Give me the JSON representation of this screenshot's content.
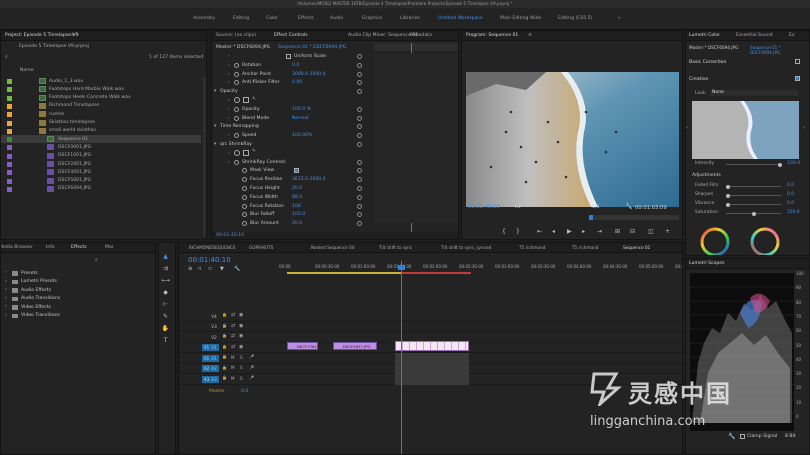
{
  "window_title": "/Volumes/MOSI2 MASTER 1KTB/Episode 4 Timelapse/Premiere Projects/Episode 5 Timelapse V9.prproj *",
  "workspaces": [
    {
      "label": "Assembly",
      "active": false
    },
    {
      "label": "Editing",
      "active": false
    },
    {
      "label": "Color",
      "active": false
    },
    {
      "label": "Effects",
      "active": false
    },
    {
      "label": "Audio",
      "active": false
    },
    {
      "label": "Graphics",
      "active": false
    },
    {
      "label": "Libraries",
      "active": false
    },
    {
      "label": "Untitled Workspace",
      "active": true
    },
    {
      "label": "Main Editing Wide",
      "active": false
    },
    {
      "label": "Editing (CS5.5)",
      "active": false
    },
    {
      "label": "»",
      "active": false
    }
  ],
  "project": {
    "title": "Project: Episode 5 Timelapse V9",
    "file": "Episode 5 Timelapse V9.prproj",
    "count": "1 of 127 items selected",
    "column": "Name",
    "items": [
      {
        "name": "Audio_1_3.wav",
        "color": "#6bbf3a",
        "kind": "audio"
      },
      {
        "name": "Footsteps Hard Marble Walk.wav",
        "color": "#6bbf3a",
        "kind": "audio"
      },
      {
        "name": "Footsteps Heels Concrete Walk.wav",
        "color": "#6bbf3a",
        "kind": "audio"
      },
      {
        "name": "Richmond Timelapses",
        "color": "#e8a43a",
        "kind": "folder"
      },
      {
        "name": "rushes",
        "color": "#e8a43a",
        "kind": "folder"
      },
      {
        "name": "Skiathos timelapses",
        "color": "#e8a43a",
        "kind": "folder"
      },
      {
        "name": "small world skiathos",
        "color": "#e8a43a",
        "kind": "folder"
      },
      {
        "name": "Sequence 01",
        "color": "#3a8a3a",
        "kind": "sequence"
      },
      {
        "name": "DSCF0001.JPG",
        "color": "#8a5cc7",
        "kind": "image"
      },
      {
        "name": "DSCF1001.JPG",
        "color": "#8a5cc7",
        "kind": "image"
      },
      {
        "name": "DSCF2001.JPG",
        "color": "#8a5cc7",
        "kind": "image"
      },
      {
        "name": "DSCF4001.JPG",
        "color": "#8a5cc7",
        "kind": "image"
      },
      {
        "name": "DSCF5001.JPG",
        "color": "#8a5cc7",
        "kind": "image"
      },
      {
        "name": "DSCF6094.JPG",
        "color": "#8a5cc7",
        "kind": "image"
      }
    ]
  },
  "source_tabs": [
    "Source: (no clips)",
    "Effect Controls",
    "Audio Clip Mixer: Sequence 01",
    "Metadata"
  ],
  "effect_controls": {
    "master": "Master * DSCF6094.JPG",
    "seq": "Sequence 01 * DSCF6094.JPG",
    "timecode": "00:01:40:10",
    "rows": [
      {
        "indent": 1,
        "label": "",
        "value": "",
        "check": "Uniform Scale"
      },
      {
        "indent": 1,
        "label": "Rotation",
        "value": "0.0"
      },
      {
        "indent": 1,
        "label": "Anchor Point",
        "value": "3000.0    2000.0"
      },
      {
        "indent": 1,
        "label": "Anti-flicker Filter",
        "value": "0.00"
      },
      {
        "indent": 0,
        "label": "Opacity",
        "value": ""
      },
      {
        "indent": 1,
        "label": "",
        "value": "",
        "shapes": true
      },
      {
        "indent": 1,
        "label": "Opacity",
        "value": "100.0 %"
      },
      {
        "indent": 1,
        "label": "Blend Mode",
        "value": "Normal"
      },
      {
        "indent": 0,
        "label": "Time Remapping",
        "value": ""
      },
      {
        "indent": 1,
        "label": "Speed",
        "value": "100.00%"
      },
      {
        "indent": 0,
        "label": "qrc ShrinkRay",
        "value": ""
      },
      {
        "indent": 1,
        "label": "",
        "value": "",
        "shapes": true
      },
      {
        "indent": 1,
        "label": "ShrinkRay Controls",
        "value": ""
      },
      {
        "indent": 2,
        "label": "Mask View",
        "value": "",
        "check": ""
      },
      {
        "indent": 2,
        "label": "Focus Position",
        "value": "3615.0    2000.0"
      },
      {
        "indent": 2,
        "label": "Focus Height",
        "value": "20.0"
      },
      {
        "indent": 2,
        "label": "Focus Width",
        "value": "88.0"
      },
      {
        "indent": 2,
        "label": "Focus Rotation",
        "value": "108"
      },
      {
        "indent": 2,
        "label": "Blur Falloff",
        "value": "100.0"
      },
      {
        "indent": 2,
        "label": "Blur Amount",
        "value": "20.0"
      }
    ]
  },
  "program": {
    "title": "Program: Sequence 01",
    "timecode": "00:01:40:10",
    "fit": "Fit",
    "res": "1/4",
    "duration": "00:01:03:09"
  },
  "lumetri": {
    "tabs": [
      "Lumetri Color",
      "Essential Sound",
      "Ex"
    ],
    "master": "Master * DSCF6094.JPG",
    "seq": "Sequence 01 * DSCF6094.JPG",
    "basic": "Basic Correction",
    "creative": "Creative",
    "look_label": "Look",
    "look_value": "None",
    "intensity_label": "Intensity",
    "intensity_value": "100.0",
    "adjustments": "Adjustments",
    "adjust": [
      {
        "label": "Faded Film",
        "value": "0.0"
      },
      {
        "label": "Sharpen",
        "value": "0.0"
      },
      {
        "label": "Vibrance",
        "value": "0.0"
      },
      {
        "label": "Saturation",
        "value": "100.0"
      }
    ],
    "scopes_title": "Lumetri Scopes",
    "scope_ticks": [
      "100",
      "90",
      "80",
      "70",
      "60",
      "50",
      "40",
      "30",
      "20",
      "10",
      "0"
    ],
    "clamp": "Clamp Signal",
    "bits": "8 Bit"
  },
  "effects_panel": {
    "tabs": [
      "Media Browser",
      "Info",
      "Effects",
      "Mar"
    ],
    "items": [
      "Presets",
      "Lumetri Presets",
      "Audio Effects",
      "Audio Transitions",
      "Video Effects",
      "Video Transitions"
    ]
  },
  "timeline": {
    "tabs": [
      "RICHMONDSEQUENCE",
      "GOPRHEITS",
      "Nested Sequence 04",
      "Tilt shift to sync",
      "Tilt shift to sync_synced",
      "T5 richmond",
      "T5 richmond",
      "Sequence 01"
    ],
    "timecode": "00:01:40:10",
    "ruler": [
      "00:00",
      "00:00:30:00",
      "00:01:00:00",
      "00:01:30:00",
      "00:02:00:00",
      "00:02:30:00",
      "00:03:00:00",
      "00:03:30:00",
      "00:04:00:00",
      "00:04:30:00",
      "00:05:00:00",
      "00:05:30:00"
    ],
    "tracks": [
      {
        "label": "V4",
        "kind": "video",
        "on": false
      },
      {
        "label": "V3",
        "kind": "video",
        "on": false
      },
      {
        "label": "V2",
        "kind": "video",
        "on": false
      },
      {
        "label": "V1",
        "kind": "video",
        "on": true
      },
      {
        "label": "A1",
        "kind": "audio",
        "on": true
      },
      {
        "label": "A2",
        "kind": "audio",
        "on": true
      },
      {
        "label": "A3",
        "kind": "audio",
        "on": true
      }
    ],
    "clips": [
      "DSCF7761",
      "DSCF4637.JPG"
    ],
    "master_label": "Master",
    "master_value": "0.0"
  },
  "watermark": {
    "brand": "灵感中国",
    "url": "lingganchina.com"
  }
}
